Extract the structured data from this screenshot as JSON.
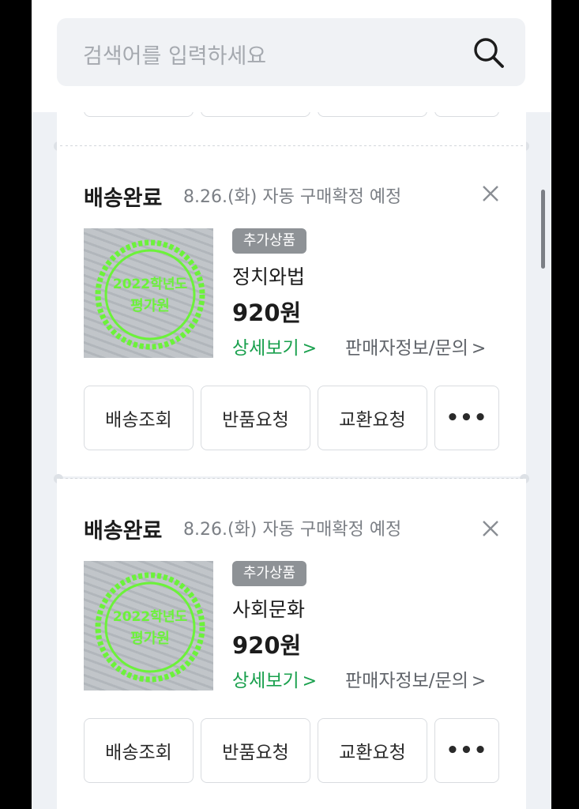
{
  "search": {
    "placeholder": "검색어를 입력하세요"
  },
  "orders": [
    {
      "status": "배송완료",
      "sub": "8.26.(화) 자동 구매확정 예정",
      "tag": "추가상품",
      "name": "정치와법",
      "price": "920원",
      "detail": "상세보기",
      "seller": "판매자정보/문의",
      "buttons": [
        "배송조회",
        "반품요청",
        "교환요청"
      ],
      "more": "•••"
    },
    {
      "status": "배송완료",
      "sub": "8.26.(화) 자동 구매확정 예정",
      "tag": "추가상품",
      "name": "사회문화",
      "price": "920원",
      "detail": "상세보기",
      "seller": "판매자정보/문의",
      "buttons": [
        "배송조회",
        "반품요청",
        "교환요청"
      ],
      "more": "•••"
    }
  ],
  "thumbnail": {
    "stamp_text_1": "2022학년도",
    "stamp_text_2": "평가원"
  },
  "colors": {
    "accent_green": "#19a04d",
    "stamp_green": "#6cf23a",
    "tag_gray": "#8e9296"
  }
}
